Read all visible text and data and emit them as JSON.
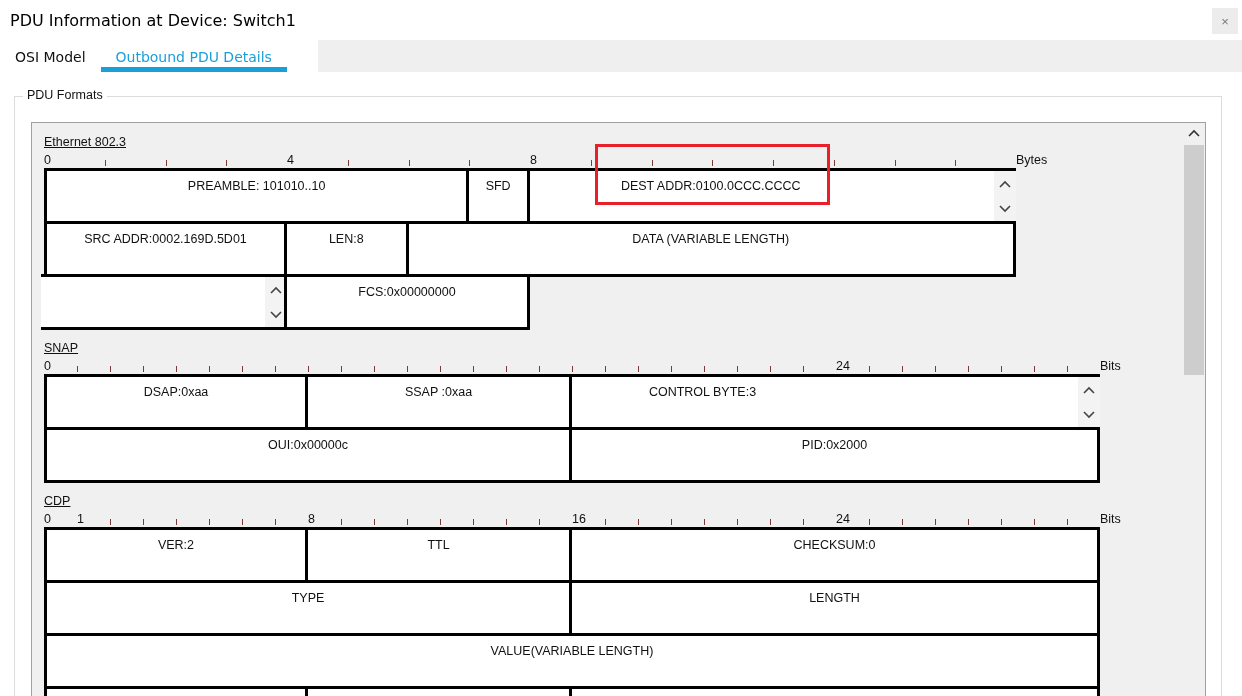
{
  "window": {
    "title": "PDU Information at Device: Switch1",
    "close": "×"
  },
  "tabs": [
    {
      "label": "OSI Model",
      "selected": false
    },
    {
      "label": "Outbound PDU Details",
      "selected": true
    }
  ],
  "group": {
    "title": "PDU Formats"
  },
  "diagrams": [
    {
      "title": "Ethernet 802.3",
      "ruler": {
        "labels": [
          "0",
          "4",
          "8"
        ],
        "unit": "Bytes"
      },
      "rows": [
        [
          {
            "kind": "field",
            "label": "PREAMBLE: 101010..10",
            "highlighted": false
          },
          {
            "kind": "field",
            "label": "SFD",
            "highlighted": false
          },
          {
            "kind": "field",
            "label": "DEST ADDR:0100.0CCC.CCCC",
            "highlighted": true
          },
          {
            "kind": "spinner"
          }
        ],
        [
          {
            "kind": "field",
            "label": "SRC ADDR:0002.169D.5D01",
            "highlighted": false
          },
          {
            "kind": "field",
            "label": "LEN:8",
            "highlighted": false
          },
          {
            "kind": "field",
            "label": "DATA (VARIABLE LENGTH)",
            "highlighted": false
          }
        ],
        [
          {
            "kind": "spinner"
          },
          {
            "kind": "field",
            "label": "FCS:0x00000000",
            "highlighted": false
          }
        ]
      ]
    },
    {
      "title": "SNAP",
      "ruler": {
        "labels": [
          "0",
          "24"
        ],
        "unit": "Bits"
      },
      "rows": [
        [
          {
            "kind": "field",
            "label": "DSAP:0xaa",
            "highlighted": false
          },
          {
            "kind": "field",
            "label": "SSAP :0xaa",
            "highlighted": false
          },
          {
            "kind": "field",
            "label": "CONTROL BYTE:3",
            "highlighted": false
          },
          {
            "kind": "spinner"
          }
        ],
        [
          {
            "kind": "field",
            "label": "OUI:0x00000c",
            "highlighted": false
          },
          {
            "kind": "field",
            "label": "PID:0x2000",
            "highlighted": false
          }
        ]
      ]
    },
    {
      "title": "CDP",
      "ruler": {
        "labels": [
          "0",
          "1",
          "8",
          "16",
          "24"
        ],
        "unit": "Bits"
      },
      "rows": [
        [
          {
            "kind": "field",
            "label": "VER:2",
            "highlighted": false
          },
          {
            "kind": "field",
            "label": "TTL",
            "highlighted": false
          },
          {
            "kind": "field",
            "label": "CHECKSUM:0",
            "highlighted": false
          }
        ],
        [
          {
            "kind": "field",
            "label": "TYPE",
            "highlighted": false,
            "colspan": 2
          },
          {
            "kind": "field",
            "label": "LENGTH",
            "highlighted": false
          }
        ],
        [
          {
            "kind": "field",
            "label": "VALUE(VARIABLE LENGTH)",
            "highlighted": false,
            "colspan": 3
          }
        ],
        [
          {
            "kind": "field"
          },
          {
            "kind": "field"
          },
          {
            "kind": "field"
          }
        ]
      ]
    }
  ]
}
